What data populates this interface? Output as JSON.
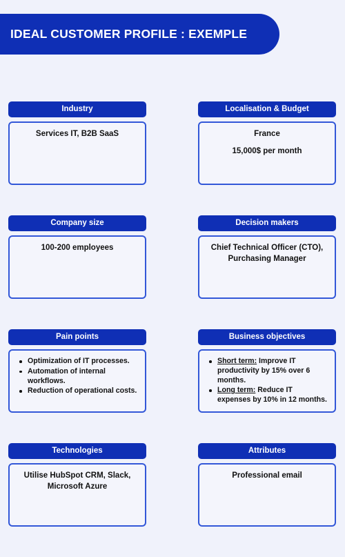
{
  "header": {
    "title": "IDEAL CUSTOMER PROFILE : EXEMPLE",
    "banner_color": "#0f2fb5",
    "title_color": "#ffffff"
  },
  "theme": {
    "page_background": "#f0f2fb",
    "accent": "#0f2fb5",
    "border": "#3257d8",
    "card_background": "#f4f5fc",
    "text": "#111111"
  },
  "cards": [
    {
      "id": "industry",
      "title": "Industry",
      "body_type": "center",
      "lines": [
        "Services IT, B2B SaaS"
      ]
    },
    {
      "id": "localisation-budget",
      "title": "Localisation & Budget",
      "body_type": "center",
      "lines": [
        "France",
        "15,000$ per month"
      ]
    },
    {
      "id": "company-size",
      "title": "Company size",
      "body_type": "center",
      "lines": [
        "100-200 employees"
      ]
    },
    {
      "id": "decision-makers",
      "title": "Decision makers",
      "body_type": "center",
      "lines": [
        "Chief Technical Officer (CTO), Purchasing Manager"
      ]
    },
    {
      "id": "pain-points",
      "title": "Pain points",
      "body_type": "list",
      "items": [
        {
          "lead": "",
          "text": "Optimization of IT processes."
        },
        {
          "lead": "",
          "text": "Automation of internal workflows."
        },
        {
          "lead": "",
          "text": "Reduction of operational costs."
        }
      ]
    },
    {
      "id": "business-objectives",
      "title": "Business objectives",
      "body_type": "list",
      "items": [
        {
          "lead": "Short term:",
          "text": "Improve IT productivity by 15% over 6 months."
        },
        {
          "lead": "Long term:",
          "text": "Reduce IT expenses by 10% in 12 months."
        }
      ]
    },
    {
      "id": "technologies",
      "title": "Technologies",
      "body_type": "center",
      "lines": [
        "Utilise HubSpot CRM, Slack, Microsoft Azure"
      ]
    },
    {
      "id": "attributes",
      "title": "Attributes",
      "body_type": "center",
      "lines": [
        "Professional email"
      ]
    }
  ]
}
